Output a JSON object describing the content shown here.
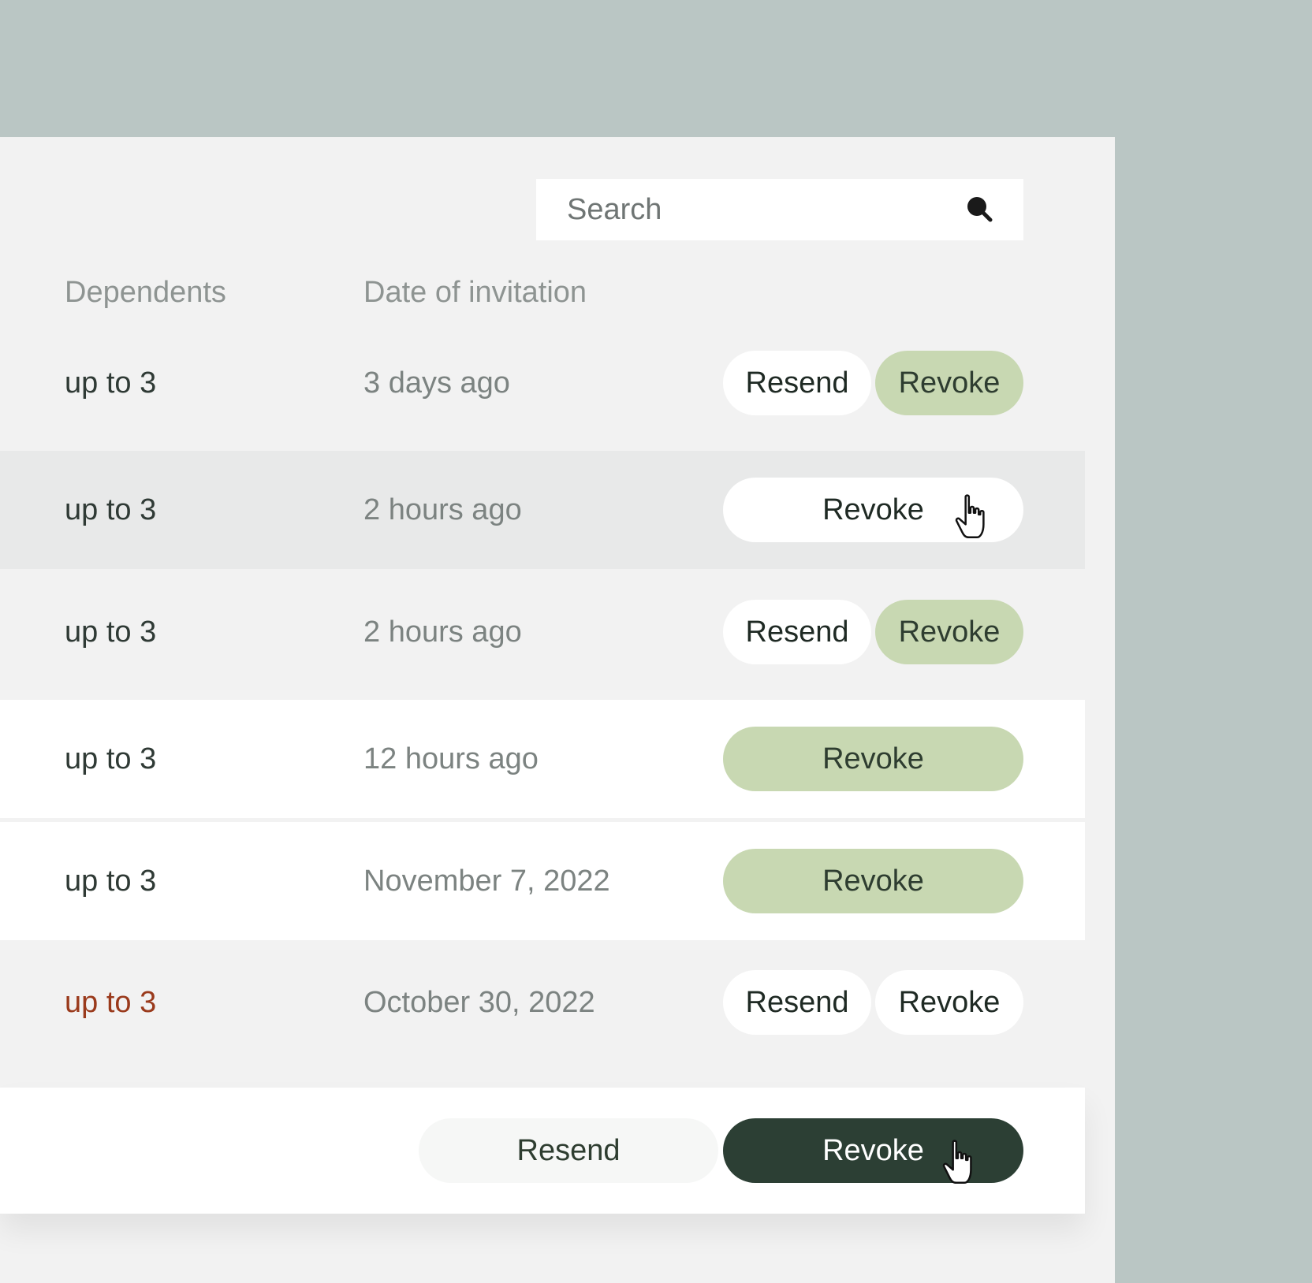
{
  "search": {
    "placeholder": "Search",
    "icon": "search-icon"
  },
  "columns": {
    "dependents": "Dependents",
    "date": "Date of invitation"
  },
  "rows": [
    {
      "dependents": "up to 3",
      "date": "3 days ago",
      "resend": "Resend",
      "revoke": "Revoke"
    },
    {
      "dependents": "up to 3",
      "date": "2 hours ago",
      "revoke": "Revoke"
    },
    {
      "dependents": "up to 3",
      "date": "2 hours ago",
      "resend": "Resend",
      "revoke": "Revoke"
    },
    {
      "dependents": "up to 3",
      "date": "12 hours ago",
      "revoke": "Revoke"
    },
    {
      "dependents": "up to 3",
      "date": "November 7, 2022",
      "revoke": "Revoke"
    },
    {
      "dependents": "up to 3",
      "date": "October 30, 2022",
      "resend": "Resend",
      "revoke": "Revoke"
    }
  ],
  "footer": {
    "resend": "Resend",
    "revoke": "Revoke"
  },
  "colors": {
    "background": "#bac6c4",
    "panel": "#f2f2f2",
    "accent_green": "#c8d8b2",
    "dark_green": "#2c3f34",
    "alert_text": "#9a3a1c"
  }
}
